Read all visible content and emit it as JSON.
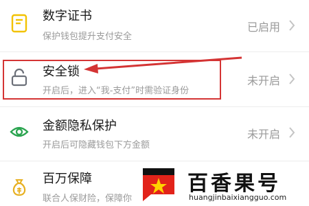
{
  "rows": [
    {
      "title": "数字证书",
      "subtitle": "保护钱包提升支付安全",
      "status": "已启用",
      "icon": "certificate-icon"
    },
    {
      "title": "安全锁",
      "subtitle": "开启后，进入“我-支付”时需验证身份",
      "status": "未开启",
      "icon": "lock-icon"
    },
    {
      "title": "金额隐私保护",
      "subtitle": "开启后可隐藏钱包下方金额",
      "status": "未开启",
      "icon": "eye-icon"
    },
    {
      "title": "百万保障",
      "subtitle": "联合人保财险，保障你",
      "status": "",
      "icon": "money-bag-icon"
    }
  ],
  "annotation": {
    "color": "#d43434"
  },
  "watermark": {
    "brand": "百香果号",
    "url": "huangjinbaixiangguo.com"
  },
  "colors": {
    "certificate_icon": "#f2c200",
    "lock_icon": "#6b6f78",
    "eye_icon": "#2aa44f",
    "bag_icon": "#e7b021",
    "chevron": "#c4c4c4"
  }
}
